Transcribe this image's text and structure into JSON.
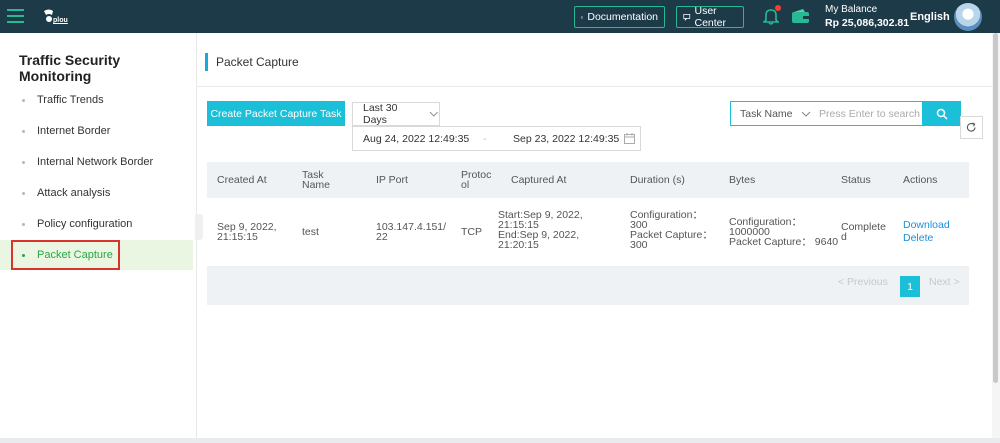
{
  "topbar": {
    "logo_text": "plou",
    "documentation_label": "Documentation",
    "user_center_label": "User Center",
    "balance_label": "My Balance",
    "balance_value": "Rp 25,086,302.81",
    "language": "English"
  },
  "sidebar": {
    "title": "Traffic Security Monitoring",
    "items": [
      {
        "label": "Traffic Trends"
      },
      {
        "label": "Internet Border"
      },
      {
        "label": "Internal Network Border"
      },
      {
        "label": "Attack analysis"
      },
      {
        "label": "Policy configuration"
      },
      {
        "label": "Packet Capture"
      }
    ]
  },
  "main": {
    "page_title": "Packet Capture",
    "create_button": "Create Packet Capture Task",
    "range_select": "Last 30 Days",
    "date_start": "Aug 24, 2022 12:49:35",
    "date_separator": "-",
    "date_end": "Sep 23, 2022 12:49:35",
    "search_field": "Task Name",
    "search_placeholder": "Press Enter to search"
  },
  "table": {
    "headers": {
      "created_at": "Created At",
      "task_name_1": "Task",
      "task_name_2": "Name",
      "ip_port": "IP Port",
      "protocol_1": "Protoc",
      "protocol_2": "ol",
      "captured_at": "Captured At",
      "duration": "Duration (s)",
      "bytes": "Bytes",
      "status": "Status",
      "actions": "Actions"
    },
    "rows": [
      {
        "created_1": "Sep 9, 2022,",
        "created_2": "21:15:15",
        "task_name": "test",
        "ip_1": "103.147.4.151/",
        "ip_2": "22",
        "protocol": "TCP",
        "cap_1": "Start:Sep 9, 2022,",
        "cap_2": "21:15:15",
        "cap_3": "End:Sep 9, 2022,",
        "cap_4": "21:20:15",
        "dur_1": "Configuration：",
        "dur_2": "300",
        "dur_3": "Packet Capture：",
        "dur_4": "300",
        "bytes_1": "Configuration：",
        "bytes_2": "1000000",
        "bytes_3": "Packet Capture： 9640",
        "status_1": "Complete",
        "status_2": "d",
        "action_download": "Download",
        "action_delete": "Delete"
      }
    ]
  },
  "pagination": {
    "previous": "< Previous",
    "page": "1",
    "next": "Next >"
  },
  "colors": {
    "topbar": "#1d3a49",
    "accent": "#1bc0d8",
    "green": "#28b894",
    "active_nav": "#28a745",
    "link": "#1a8fd9"
  }
}
